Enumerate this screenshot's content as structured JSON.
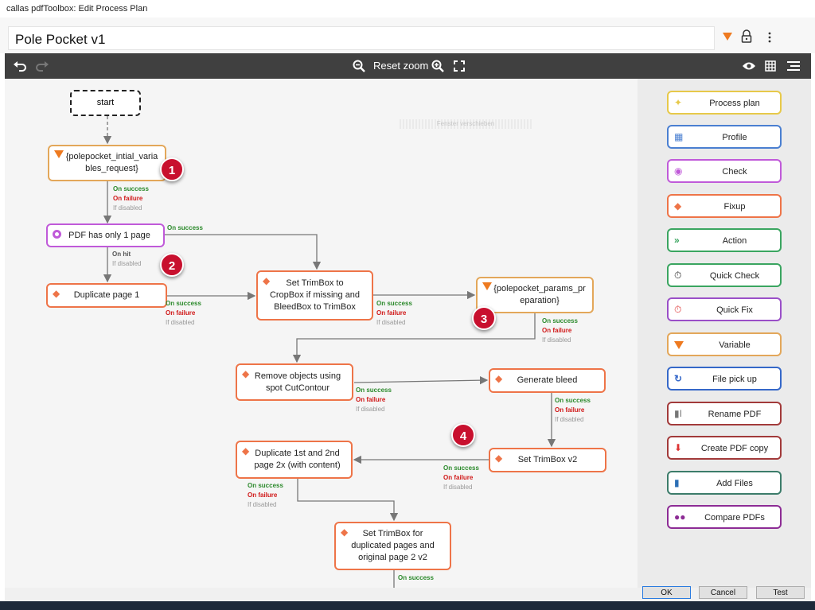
{
  "window": {
    "title": "callas pdfToolbox: Edit Process Plan"
  },
  "header": {
    "plan_name": "Pole Pocket v1"
  },
  "toolbar": {
    "reset_zoom": "Reset zoom"
  },
  "canvas": {
    "watermark": "Fenster verschieben",
    "start_label": "start",
    "nodes": {
      "var1_line1": "{polepocket_intial_varia",
      "var1_line2": "bles_request}",
      "check1": "PDF has only 1 page",
      "dup1": "Duplicate page 1",
      "trim1_l1": "Set TrimBox to",
      "trim1_l2": "CropBox if missing and",
      "trim1_l3": "BleedBox to TrimBox",
      "var2_line1": "{polepocket_params_pr",
      "var2_line2": "eparation}",
      "remove_l1": "Remove objects using",
      "remove_l2": "spot CutContour",
      "bleed": "Generate bleed",
      "trim2": "Set TrimBox v2",
      "dup2_l1": "Duplicate 1st and 2nd",
      "dup2_l2": "page 2x (with content)",
      "trim3_l1": "Set TrimBox for",
      "trim3_l2": "duplicated pages and",
      "trim3_l3": "original page 2 v2"
    },
    "edges": {
      "on_success": "On success",
      "on_failure": "On failure",
      "if_disabled": "If disabled",
      "on_hit": "On hit"
    },
    "badges": [
      "1",
      "2",
      "3",
      "4"
    ]
  },
  "palette": [
    {
      "label": "Process plan",
      "icon": "process-plan-icon",
      "color": "#e7c94a"
    },
    {
      "label": "Profile",
      "icon": "profile-icon",
      "color": "#4a7fd1"
    },
    {
      "label": "Check",
      "icon": "check-icon",
      "color": "#c05ad9"
    },
    {
      "label": "Fixup",
      "icon": "fixup-icon",
      "color": "#ee7448"
    },
    {
      "label": "Action",
      "icon": "action-icon",
      "color": "#3aa560"
    },
    {
      "label": "Quick Check",
      "icon": "quick-check-icon",
      "color": "#3aa560"
    },
    {
      "label": "Quick Fix",
      "icon": "quick-fix-icon",
      "color": "#9a4fc8"
    },
    {
      "label": "Variable",
      "icon": "variable-icon",
      "color": "#e3a75a"
    },
    {
      "label": "File pick up",
      "icon": "file-pickup-icon",
      "color": "#3568c9"
    },
    {
      "label": "Rename PDF",
      "icon": "rename-pdf-icon",
      "color": "#a23a3a"
    },
    {
      "label": "Create PDF copy",
      "icon": "create-pdf-copy-icon",
      "color": "#a23a3a"
    },
    {
      "label": "Add Files",
      "icon": "add-files-icon",
      "color": "#3c7c6a"
    },
    {
      "label": "Compare PDFs",
      "icon": "compare-pdfs-icon",
      "color": "#8d2c95"
    }
  ],
  "footer": {
    "ok": "OK",
    "cancel": "Cancel",
    "test": "Test"
  },
  "colors": {
    "fixup": "#ee7448",
    "variable": "#e3a75a",
    "check": "#c05ad9",
    "success": "#2c8a2c",
    "failure": "#d01818",
    "badge": "#c8102e"
  }
}
